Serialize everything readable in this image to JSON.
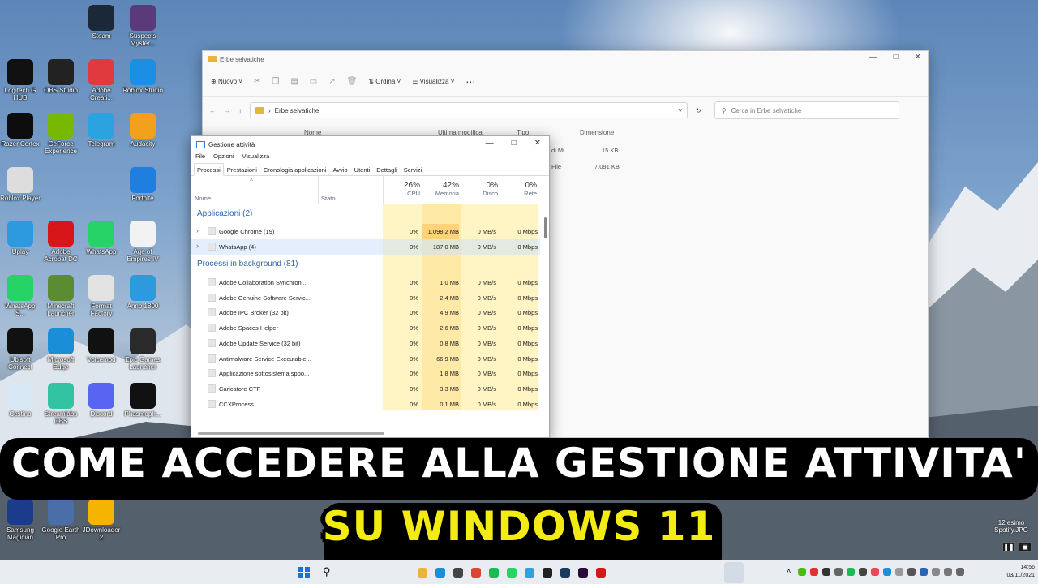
{
  "desktop_icons": [
    {
      "label": "Steam",
      "icon": "steam-icon",
      "color": "#1b2838"
    },
    {
      "label": "Suspects Myster...",
      "icon": "suspects-icon",
      "color": "#5a3a7a"
    },
    {
      "label": "Logitech G HUB",
      "icon": "logitech-icon",
      "color": "#111111"
    },
    {
      "label": "OBS Studio",
      "icon": "obs-icon",
      "color": "#222222"
    },
    {
      "label": "Adobe Creati...",
      "icon": "adobe-cc-icon",
      "color": "#e03a3e"
    },
    {
      "label": "Roblox Studio",
      "icon": "roblox-studio-icon",
      "color": "#1b8fe6"
    },
    {
      "label": "Razer Cortex",
      "icon": "razer-icon",
      "color": "#0d0d0d"
    },
    {
      "label": "GeForce Experience",
      "icon": "geforce-icon",
      "color": "#76b900"
    },
    {
      "label": "Telegram",
      "icon": "telegram-icon",
      "color": "#2aa3e0"
    },
    {
      "label": "Audacity",
      "icon": "audacity-icon",
      "color": "#f1a21a"
    },
    {
      "label": "Roblox Player",
      "icon": "roblox-icon",
      "color": "#dddddd"
    },
    {
      "label": "Fortnite",
      "icon": "fortnite-icon",
      "color": "#1f7fe0"
    },
    {
      "label": "Uplay",
      "icon": "uplay-icon",
      "color": "#2d9ae0"
    },
    {
      "label": "Adobe Acrobat DC",
      "icon": "acrobat-icon",
      "color": "#d8161a"
    },
    {
      "label": "WhatsApp",
      "icon": "whatsapp-icon",
      "color": "#25d366"
    },
    {
      "label": "Age of Empires IV",
      "icon": "file-icon",
      "color": "#f2f2f2"
    },
    {
      "label": "WhatsApp S...",
      "icon": "whatsapp-icon",
      "color": "#25d366"
    },
    {
      "label": "Minecraft Launcher",
      "icon": "minecraft-icon",
      "color": "#5b8c32"
    },
    {
      "label": "Format Factory",
      "icon": "formatfactory-icon",
      "color": "#e3e3e3"
    },
    {
      "label": "Anno 1800",
      "icon": "uplay-icon",
      "color": "#2d9ae0"
    },
    {
      "label": "Ubisoft Connect",
      "icon": "ubisoft-icon",
      "color": "#111111"
    },
    {
      "label": "Microsoft Edge",
      "icon": "edge-icon",
      "color": "#1a8fd8"
    },
    {
      "label": "Voicemod",
      "icon": "voicemod-icon",
      "color": "#111111"
    },
    {
      "label": "Epic Games Launcher",
      "icon": "epic-icon",
      "color": "#2a2a2a"
    },
    {
      "label": "Cestino",
      "icon": "recycle-bin-icon",
      "color": "#d8e8f4"
    },
    {
      "label": "Streamlabs OBS",
      "icon": "streamlabs-icon",
      "color": "#31c3a2"
    },
    {
      "label": "Discord",
      "icon": "discord-icon",
      "color": "#5865f2"
    },
    {
      "label": "Phasmoph...",
      "icon": "phasmophobia-icon",
      "color": "#111111"
    },
    {
      "label": "Samsung Magician",
      "icon": "samsung-icon",
      "color": "#1b3c8a"
    },
    {
      "label": "Google Earth Pro",
      "icon": "google-earth-icon",
      "color": "#4a6ea8"
    },
    {
      "label": "JDownloader 2",
      "icon": "jdownloader-icon",
      "color": "#f4b400"
    }
  ],
  "explorer": {
    "title": "Erbe selvatiche",
    "toolbar": {
      "new": "Nuovo",
      "sort": "Ordina",
      "view": "Visualizza"
    },
    "address": "Erbe selvatiche",
    "search_placeholder": "Cerca in Erbe selvatiche",
    "columns": {
      "name": "Nome",
      "modified": "Ultima modifica",
      "type": "Tipo",
      "size": "Dimensione"
    },
    "rows": [
      {
        "type": "di Mi...",
        "size": "15 KB"
      },
      {
        "type": "File",
        "size": "7.091 KB"
      }
    ]
  },
  "taskmgr": {
    "title": "Gestione attività",
    "menu": [
      "File",
      "Opzioni",
      "Visualizza"
    ],
    "tabs": [
      "Processi",
      "Prestazioni",
      "Cronologia applicazioni",
      "Avvio",
      "Utenti",
      "Dettagli",
      "Servizi"
    ],
    "headers": {
      "name": "Nome",
      "status": "Stato",
      "cpu_pct": "26%",
      "cpu": "CPU",
      "mem_pct": "42%",
      "mem": "Memoria",
      "disk_pct": "0%",
      "disk": "Disco",
      "net_pct": "0%",
      "net": "Rete"
    },
    "groups": {
      "apps": "Applicazioni (2)",
      "background": "Processi in background (81)"
    },
    "apps": [
      {
        "name": "Google Chrome (19)",
        "cpu": "0%",
        "mem": "1.098,2 MB",
        "disk": "0 MB/s",
        "net": "0 Mbps"
      },
      {
        "name": "WhatsApp (4)",
        "cpu": "0%",
        "mem": "187,0 MB",
        "disk": "0 MB/s",
        "net": "0 Mbps"
      }
    ],
    "background": [
      {
        "name": "Adobe Collaboration Synchroni...",
        "cpu": "0%",
        "mem": "1,0 MB",
        "disk": "0 MB/s",
        "net": "0 Mbps"
      },
      {
        "name": "Adobe Genuine Software Servic...",
        "cpu": "0%",
        "mem": "2,4 MB",
        "disk": "0 MB/s",
        "net": "0 Mbps"
      },
      {
        "name": "Adobe IPC Broker (32 bit)",
        "cpu": "0%",
        "mem": "4,9 MB",
        "disk": "0 MB/s",
        "net": "0 Mbps"
      },
      {
        "name": "Adobe Spaces Helper",
        "cpu": "0%",
        "mem": "2,6 MB",
        "disk": "0 MB/s",
        "net": "0 Mbps"
      },
      {
        "name": "Adobe Update Service (32 bit)",
        "cpu": "0%",
        "mem": "0,8 MB",
        "disk": "0 MB/s",
        "net": "0 Mbps"
      },
      {
        "name": "Antimalware Service Executable...",
        "cpu": "0%",
        "mem": "66,9 MB",
        "disk": "0 MB/s",
        "net": "0 Mbps"
      },
      {
        "name": "Applicazione sottosistema spoo...",
        "cpu": "0%",
        "mem": "1,8 MB",
        "disk": "0 MB/s",
        "net": "0 Mbps"
      },
      {
        "name": "Caricatore CTF",
        "cpu": "0%",
        "mem": "3,3 MB",
        "disk": "0 MB/s",
        "net": "0 Mbps"
      },
      {
        "name": "CCXProcess",
        "cpu": "0%",
        "mem": "0,1 MB",
        "disk": "0 MB/s",
        "net": "0 Mbps"
      }
    ]
  },
  "headline": {
    "line1": "COME ACCEDERE ALLA GESTIONE ATTIVITA'",
    "line2": "SU WINDOWS 11"
  },
  "notification": {
    "label": "12 esimo Spotify.JPG"
  },
  "tray": {
    "time": "14:56",
    "date": "03/11/2021"
  },
  "colors": {
    "heat_light": "#fff4c4",
    "heat_mid": "#ffe9a6",
    "heat_strong": "#fcd37a",
    "accent": "#2a63b1"
  }
}
